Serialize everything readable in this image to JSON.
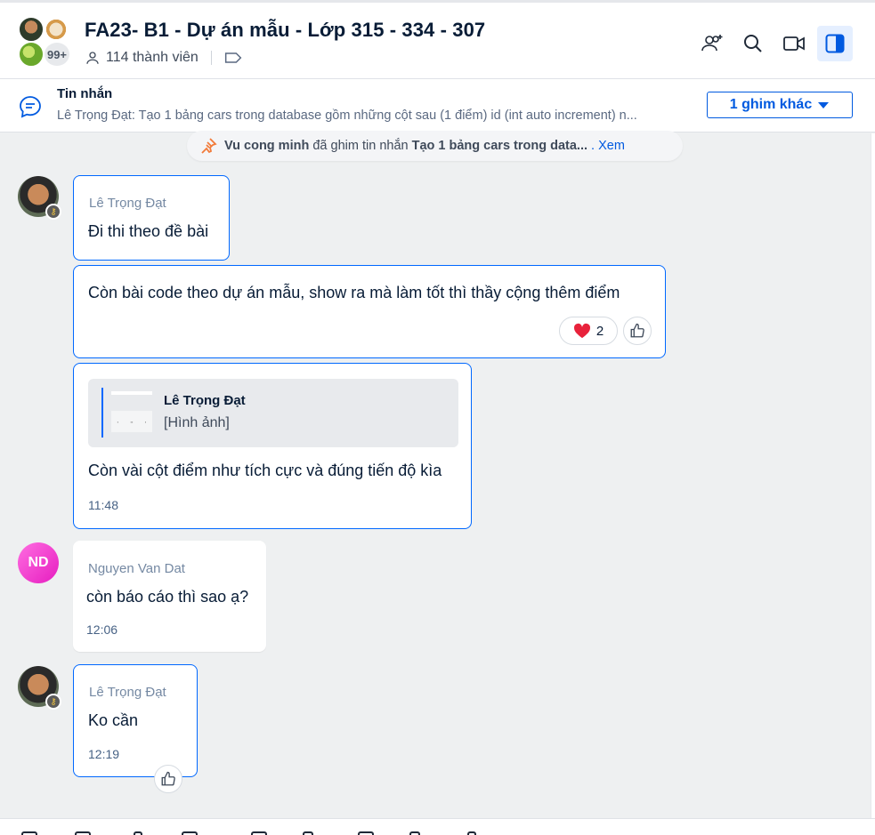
{
  "header": {
    "title": "FA23- B1 - Dự án mẫu - Lớp 315 - 334 - 307",
    "members": "114 thành viên",
    "overflow_badge": "99+"
  },
  "pinned": {
    "title": "Tin nhắn",
    "preview": "Lê Trọng Đạt: Tạo 1 bảng cars trong database gồm những cột sau (1 điểm) id (int auto increment) n...",
    "more_label": "1 ghim khác"
  },
  "system_note": {
    "actor": "Vu cong minh",
    "action": "đã ghim tin nhắn",
    "message": "Tạo 1 bảng cars trong data...",
    "link": ". Xem"
  },
  "messages": [
    {
      "sender": "Lê Trọng Đạt",
      "text": "Đi thi theo đề bài"
    },
    {
      "text": "Còn bài code theo dự án mẫu, show ra  mà làm tốt thì thầy cộng thêm điểm",
      "reaction_count": "2"
    },
    {
      "quote_sender": "Lê Trọng Đạt",
      "quote_text": "[Hình ảnh]",
      "text": "Còn vài cột điểm như tích cực và đúng tiến độ kìa",
      "time": "11:48"
    },
    {
      "sender": "Nguyen Van Dat",
      "avatar_initials": "ND",
      "text": "còn báo cáo thì sao ạ?",
      "time": "12:06"
    },
    {
      "sender": "Lê Trọng Đạt",
      "text": "Ko cần",
      "time": "12:19"
    }
  ],
  "colors": {
    "accent": "#0068ff",
    "link": "#005ae0",
    "chat_bg": "#eef0f1",
    "pin_orange": "#f27b3a"
  },
  "icons": [
    "add-member-icon",
    "search-icon",
    "video-call-icon",
    "sidebar-toggle-icon",
    "chat-bubble-icon",
    "pin-icon",
    "heart-icon",
    "like-icon",
    "key-icon",
    "person-icon",
    "tag-icon",
    "caret-down-icon"
  ]
}
